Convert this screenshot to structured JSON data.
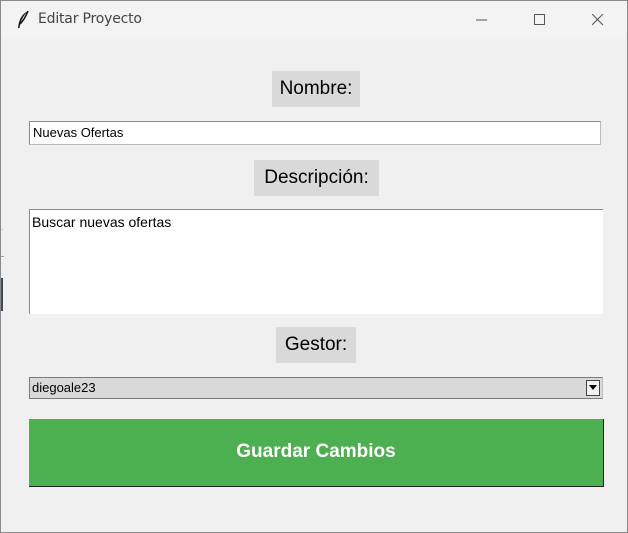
{
  "window": {
    "title": "Editar Proyecto",
    "icon": "feather-icon"
  },
  "window_controls": {
    "minimize": "minimize-icon",
    "maximize": "maximize-icon",
    "close": "close-icon"
  },
  "form": {
    "nombre_label": "Nombre:",
    "nombre_value": "Nuevas Ofertas",
    "descripcion_label": "Descripción:",
    "descripcion_value": "Buscar nuevas ofertas",
    "gestor_label": "Gestor:",
    "gestor_selected": "diegoale23",
    "save_label": "Guardar Cambios"
  },
  "colors": {
    "save_button": "#4caf50",
    "label_bg": "#d9d9d9",
    "window_bg": "#f0f0f0"
  }
}
